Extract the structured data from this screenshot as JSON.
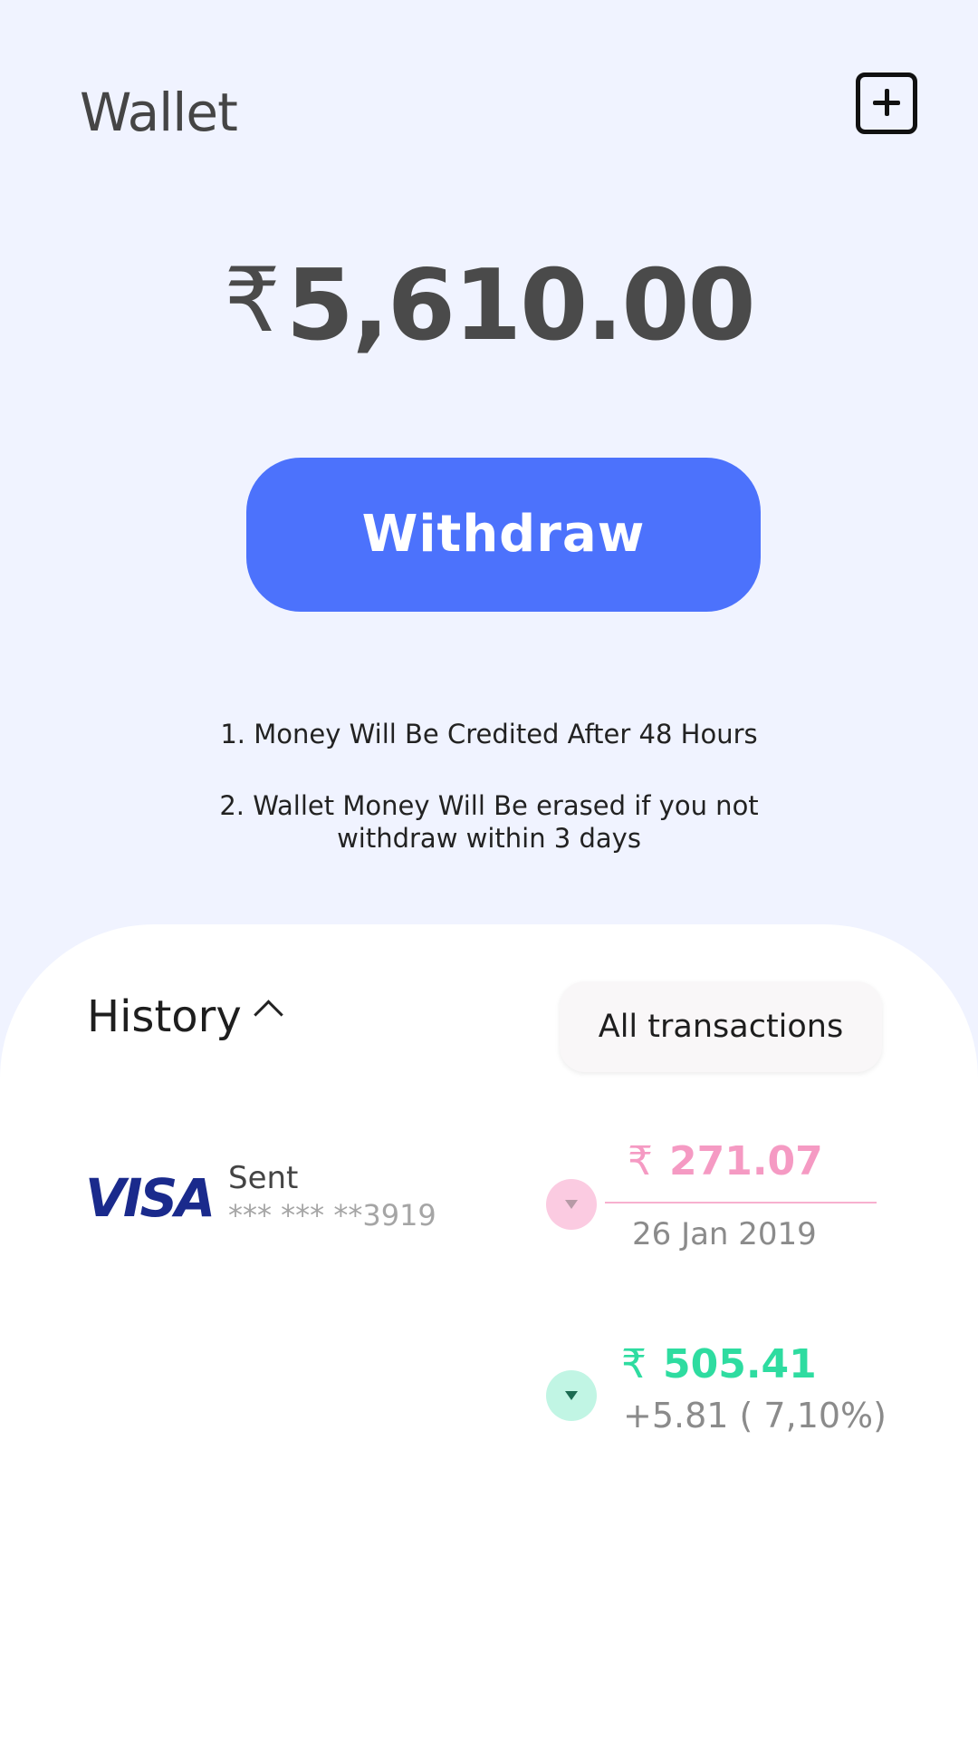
{
  "header": {
    "title": "Wallet",
    "add_icon": "plus-square-icon"
  },
  "balance": {
    "currency_symbol": "₹",
    "amount": "5,610.00"
  },
  "actions": {
    "withdraw_label": "Withdraw",
    "withdraw_color": "#4c72fc"
  },
  "notes": {
    "note1": "1. Money Will Be Credited After 48 Hours",
    "note2_line1": "2. Wallet Money Will Be erased if you not",
    "note2_line2": "withdraw within 3 days"
  },
  "history": {
    "title": "History",
    "toggle_icon": "chevron-up-icon",
    "filter_label": "All transactions",
    "transactions": [
      {
        "brand": "VISA",
        "type_label": "Sent",
        "card_number": "*** *** **3919",
        "currency_symbol": "₹",
        "amount": "271.07",
        "date": "26 Jan 2019",
        "indicator_icon": "down-triangle-icon",
        "color": "#f59ac3"
      },
      {
        "currency_symbol": "₹",
        "amount": "505.41",
        "change": "+5.81 ( 7,10%)",
        "indicator_icon": "down-triangle-icon",
        "color": "#2edca0"
      }
    ]
  }
}
